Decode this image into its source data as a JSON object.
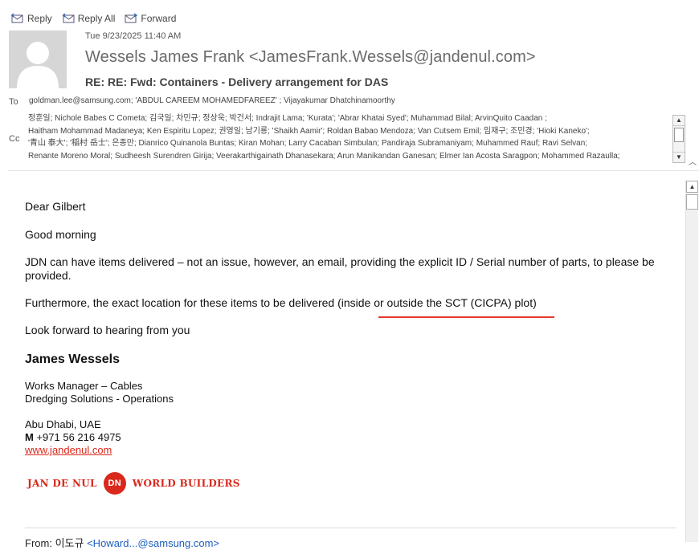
{
  "toolbar": {
    "reply": "Reply",
    "reply_all": "Reply All",
    "forward": "Forward"
  },
  "header": {
    "date": "Tue 9/23/2025 11:40 AM",
    "sender": "Wessels James Frank <JamesFrank.Wessels@jandenul.com>",
    "subject": "RE: RE: Fwd: Containers - Delivery arrangement for DAS",
    "to_label": "To",
    "to": "goldman.lee@samsung.com; 'ABDUL CAREEM MOHAMEDFAREEZ'    ; Vijayakumar Dhatchinamoorthy",
    "cc_label": "Cc",
    "cc_lines": [
      "정훈일; Nichole Babes C Cometa; 김국일; 차민규; 정상욱; 박건서; Indrajit Lama; 'Kurata'; 'Abrar Khatai Syed'; Muhammad Bilal; ArvinQuito Caadan    ;",
      "Haitham Mohammad Madaneya; Ken Espiritu Lopez; 권영일; 남기룡; 'Shaikh Aamir'; Roldan Babao Mendoza; Van Cutsem Emil; 임재구; 조민경; 'Hioki Kaneko';",
      "'青山 泰大'; '稲村 岳士'; 은종만; Dianrico Quinanola Buntas; Kiran Mohan; Larry Cacaban Simbulan; Pandiraja Subramaniyam; Muhammed Rauf; Ravi Selvan;",
      "Renante Moreno Moral; Sudheesh Surendren Girija; Veerakarthigainath Dhanasekara; Arun Manikandan Ganesan; Elmer Ian Acosta Saragpon; Mohammed Razaulla;"
    ]
  },
  "body": {
    "greeting": "Dear Gilbert",
    "good_morning": "Good morning",
    "para1": "JDN can have items delivered – not an issue, however, an email, providing the explicit ID / Serial number of parts, to please be provided.",
    "para2": "Furthermore, the exact location for these items to be delivered (inside or outside the SCT (CICPA) plot)",
    "closing": "Look forward to hearing from you",
    "sig_name": "James Wessels",
    "sig_title1": "Works Manager – Cables",
    "sig_title2": "Dredging Solutions - Operations",
    "sig_location": "Abu Dhabi, UAE",
    "sig_phone_label": "M",
    "sig_phone": "+971 56 216 4975",
    "sig_link": "www.jandenul.com",
    "logo_left": "JAN DE NUL",
    "logo_mid": "DN",
    "logo_right": "WORLD BUILDERS"
  },
  "footer": {
    "from_label": "From:",
    "from_name": "이도규",
    "from_email": "<Howard...@samsung.com>"
  },
  "colors": {
    "accent": "#e53a2e",
    "brand_red": "#d9281c",
    "link": "#1f5fbf"
  },
  "icons": [
    "reply-icon",
    "reply-all-icon",
    "forward-icon",
    "avatar-icon",
    "scroll-up-icon",
    "scroll-down-icon",
    "expand-icon"
  ]
}
